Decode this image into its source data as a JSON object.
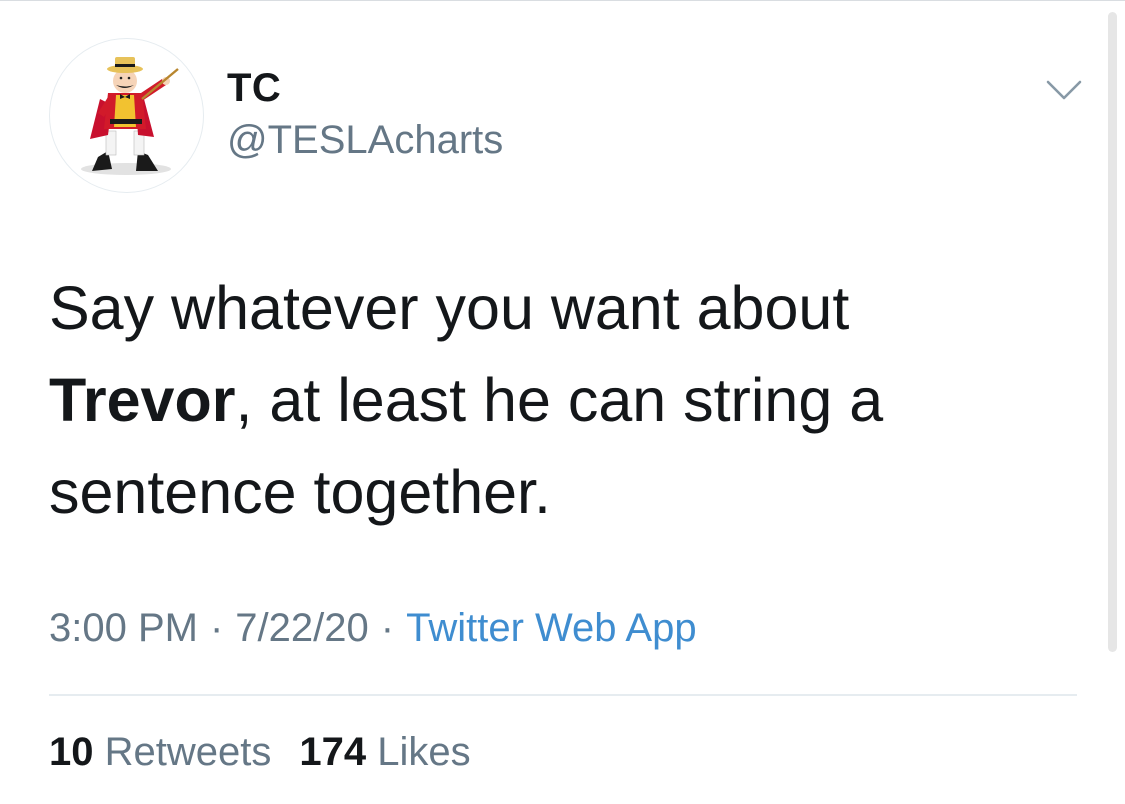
{
  "tweet": {
    "author": {
      "display_name": "TC",
      "handle": "@TESLAcharts",
      "avatar_icon": "ringmaster-avatar-icon"
    },
    "menu_icon": "chevron-down-icon",
    "text": {
      "line1": "Say whatever you want about",
      "bold_word": "Trevor",
      "line2_rest": ", at least he can string a",
      "line3": "sentence together."
    },
    "meta": {
      "time": "3:00 PM",
      "separator": "·",
      "date": "7/22/20",
      "source": "Twitter Web App"
    },
    "stats": {
      "retweets_count": "10",
      "retweets_label": "Retweets",
      "likes_count": "174",
      "likes_label": "Likes"
    }
  },
  "colors": {
    "text_primary": "#14171a",
    "text_secondary": "#657786",
    "link": "#3f8dd0",
    "divider": "#e6ecf0"
  }
}
